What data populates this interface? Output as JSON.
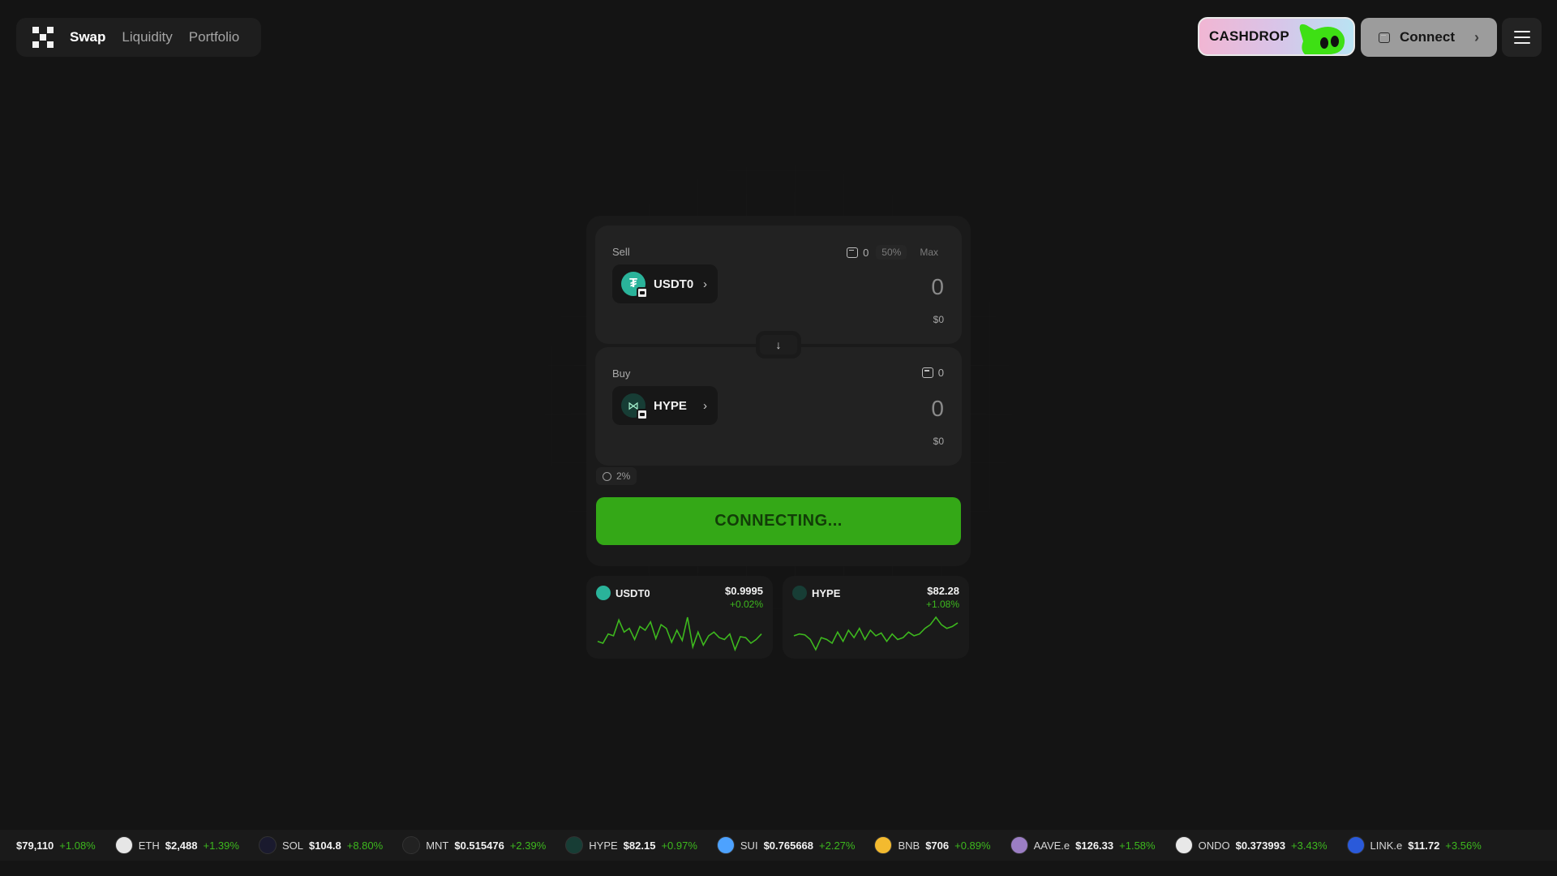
{
  "nav": {
    "links": [
      "Swap",
      "Liquidity",
      "Portfolio"
    ],
    "cashdrop_label": "CASHDROP",
    "connect_label": "Connect"
  },
  "swap": {
    "sell": {
      "label": "Sell",
      "balance": "0",
      "chip_half": "50%",
      "chip_max": "Max",
      "token": "USDT0",
      "amount": "0",
      "usd_value": "$0"
    },
    "buy": {
      "label": "Buy",
      "balance": "0",
      "token": "HYPE",
      "amount": "0",
      "usd_value": "$0"
    },
    "slippage": "2%",
    "cta_label": "CONNECTING..."
  },
  "price_cards": [
    {
      "token": "USDT0",
      "price": "$0.9995",
      "change": "+0.02%",
      "spark": [
        12,
        10,
        20,
        18,
        35,
        22,
        26,
        14,
        28,
        24,
        33,
        15,
        30,
        26,
        11,
        24,
        13,
        38,
        6,
        22,
        8,
        18,
        22,
        16,
        14,
        20,
        3,
        17,
        16,
        10,
        14,
        20
      ]
    },
    {
      "token": "HYPE",
      "price": "$82.28",
      "change": "+1.08%",
      "spark": [
        18,
        20,
        19,
        14,
        3,
        16,
        14,
        10,
        22,
        12,
        24,
        16,
        26,
        14,
        24,
        18,
        21,
        12,
        20,
        14,
        16,
        22,
        18,
        20,
        26,
        30,
        38,
        30,
        26,
        28,
        32
      ]
    }
  ],
  "ticker": [
    {
      "symbol": "",
      "price": "$79,110",
      "change": "+1.08%",
      "color": "#f7931a"
    },
    {
      "symbol": "ETH",
      "price": "$2,488",
      "change": "+1.39%",
      "color": "#e6e6e6"
    },
    {
      "symbol": "SOL",
      "price": "$104.8",
      "change": "+8.80%",
      "color": "#1a1a2e"
    },
    {
      "symbol": "MNT",
      "price": "$0.515476",
      "change": "+2.39%",
      "color": "#222222"
    },
    {
      "symbol": "HYPE",
      "price": "$82.15",
      "change": "+0.97%",
      "color": "#173d35"
    },
    {
      "symbol": "SUI",
      "price": "$0.765668",
      "change": "+2.27%",
      "color": "#4da2ff"
    },
    {
      "symbol": "BNB",
      "price": "$706",
      "change": "+0.89%",
      "color": "#f3ba2f"
    },
    {
      "symbol": "AAVE.e",
      "price": "$126.33",
      "change": "+1.58%",
      "color": "#9b7ec4"
    },
    {
      "symbol": "ONDO",
      "price": "$0.373993",
      "change": "+3.43%",
      "color": "#e8e8e8"
    },
    {
      "symbol": "LINK.e",
      "price": "$11.72",
      "change": "+3.56%",
      "color": "#2a5ada"
    }
  ],
  "colors": {
    "accent_green": "#34a817",
    "positive": "#3db81e",
    "background": "#141414"
  }
}
